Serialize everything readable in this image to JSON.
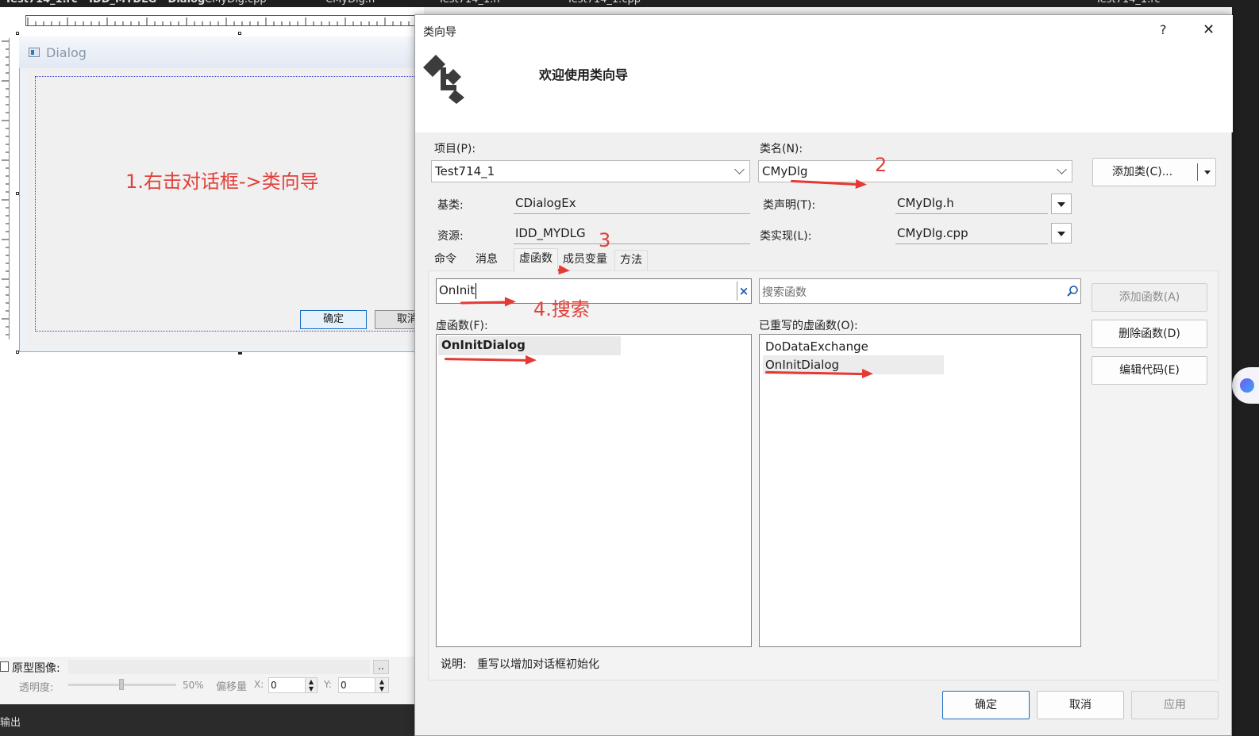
{
  "editor_tabs": [
    "Test714_1.rc - IDD_MYDLG - Dialog",
    "CMyDlg.cpp",
    "CMyDlg.h",
    "Test714_1.h",
    "Test714_1.cpp",
    "Test714_1.rc"
  ],
  "designer": {
    "dialog_title": "Dialog",
    "ok_label": "确定",
    "cancel_label": "取消"
  },
  "annotations": {
    "step1": "1.右击对话框->类向导",
    "step2": "2",
    "step3": "3",
    "step4": "4.搜索"
  },
  "props": {
    "proto_label": "原型图像:",
    "browse": "..",
    "opacity_label": "透明度:",
    "opacity_value": 0.5,
    "opacity_text": "50%",
    "offset_label": "偏移量",
    "x_label": "X:",
    "x_value": "0",
    "y_label": "Y:",
    "y_value": "0"
  },
  "output_panel": {
    "title": "输出"
  },
  "wizard": {
    "title": "类向导",
    "help": "?",
    "close": "✕",
    "welcome": "欢迎使用类向导",
    "project_label": "项目(P):",
    "project_value": "Test714_1",
    "classname_label": "类名(N):",
    "classname_value": "CMyDlg",
    "add_class_label": "添加类(C)...",
    "base_label": "基类:",
    "base_value": "CDialogEx",
    "decl_label": "类声明(T):",
    "decl_value": "CMyDlg.h",
    "resource_label": "资源:",
    "resource_value": "IDD_MYDLG",
    "impl_label": "类实现(L):",
    "impl_value": "CMyDlg.cpp",
    "tabs": [
      "命令",
      "消息",
      "虚函数",
      "成员变量",
      "方法"
    ],
    "search_value": "OnInit",
    "search_placeholder": "搜索函数",
    "virtual_label": "虚函数(F):",
    "virtual_items": [
      "OnInitDialog"
    ],
    "overridden_label": "已重写的虚函数(O):",
    "overridden_items": [
      "DoDataExchange",
      "OnInitDialog"
    ],
    "add_func_label": "添加函数(A)",
    "del_func_label": "删除函数(D)",
    "edit_code_label": "编辑代码(E)",
    "desc_label": "说明:",
    "desc_text": "重写以增加对话框初始化",
    "ok_label": "确定",
    "cancel_label": "取消",
    "apply_label": "应用"
  }
}
